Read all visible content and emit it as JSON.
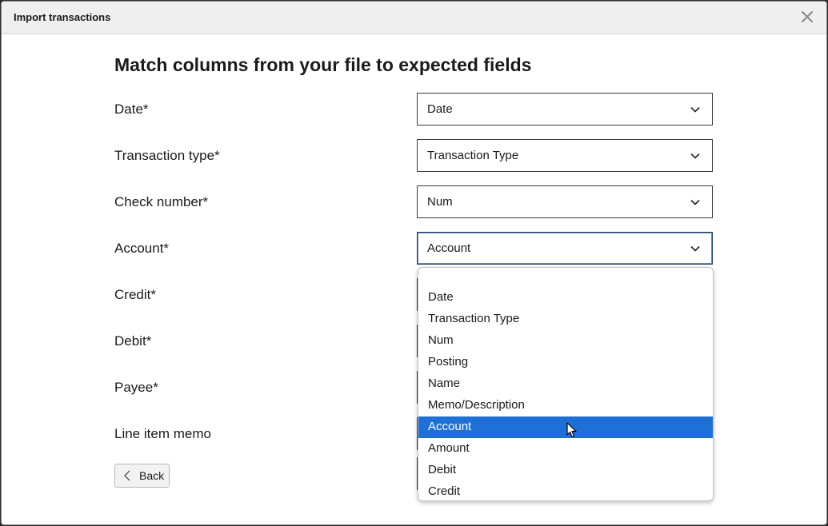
{
  "dialog": {
    "title": "Import transactions",
    "heading": "Match columns from your file to expected fields"
  },
  "fields": [
    {
      "label": "Date*",
      "value": "Date"
    },
    {
      "label": "Transaction type*",
      "value": "Transaction Type"
    },
    {
      "label": "Check number*",
      "value": "Num"
    },
    {
      "label": "Account*",
      "value": "Account"
    },
    {
      "label": "Credit*",
      "value": ""
    },
    {
      "label": "Debit*",
      "value": ""
    },
    {
      "label": "Payee*",
      "value": ""
    },
    {
      "label": "Line item memo",
      "value": ""
    }
  ],
  "dropdown": {
    "options": [
      "",
      "Date",
      "Transaction Type",
      "Num",
      "Posting",
      "Name",
      "Memo/Description",
      "Account",
      "Amount",
      "Debit",
      "Credit"
    ],
    "selected": "Account"
  },
  "back_button": {
    "label": "Back"
  },
  "colors": {
    "selected_option": "#1e6fd6",
    "focus_border": "#1f3f66"
  },
  "icons": {
    "close": "close-icon",
    "select_arrow": "chevron-down-icon",
    "back": "chevron-left-icon",
    "pointer": "mouse-pointer-icon"
  }
}
